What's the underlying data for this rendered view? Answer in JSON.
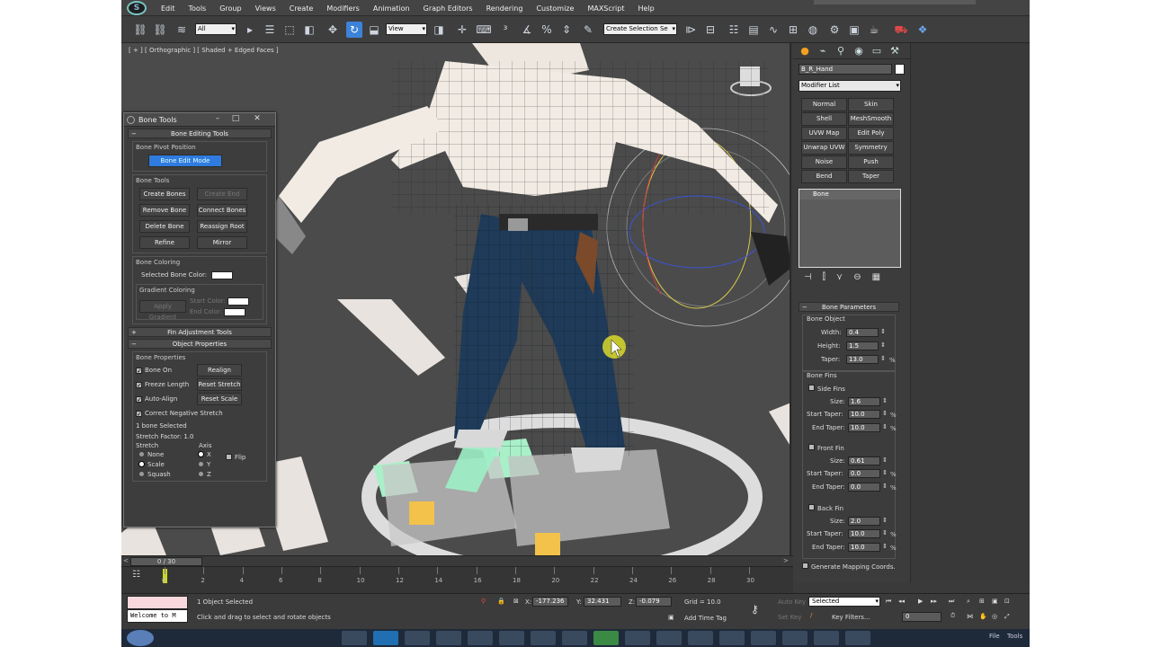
{
  "app": {
    "logo_text": "S"
  },
  "menu": [
    "Edit",
    "Tools",
    "Group",
    "Views",
    "Create",
    "Modifiers",
    "Animation",
    "Graph Editors",
    "Rendering",
    "Customize",
    "MAXScript",
    "Help"
  ],
  "toolbar": {
    "filter_value": "All",
    "refcoord_value": "View",
    "selection_set_placeholder": "Create Selection Se"
  },
  "viewport": {
    "label": "[ + ] [ Orthographic ] [ Shaded + Edged Faces ]"
  },
  "bone_tools": {
    "title": "Bone Tools",
    "editing_header": "Bone Editing Tools",
    "pivot_group": "Bone Pivot Position",
    "bone_edit_mode": "Bone Edit Mode",
    "tools_group": "Bone Tools",
    "buttons": [
      "Create Bones",
      "Create End",
      "Remove Bone",
      "Connect Bones",
      "Delete Bone",
      "Reassign Root",
      "Refine",
      "Mirror"
    ],
    "coloring_group": "Bone Coloring",
    "selected_color_label": "Selected Bone Color:",
    "gradient_group": "Gradient Coloring",
    "apply_gradient": "Apply Gradient",
    "start_color": "Start Color:",
    "end_color": "End Color:",
    "fin_header": "Fin Adjustment Tools",
    "object_props_header": "Object Properties",
    "bone_props_group": "Bone Properties",
    "bone_on": "Bone On",
    "realign": "Realign",
    "freeze_length": "Freeze Length",
    "reset_stretch": "Reset Stretch",
    "auto_align": "Auto-Align",
    "reset_scale": "Reset Scale",
    "correct_neg": "Correct Negative Stretch",
    "selected_count": "1 bone Selected",
    "stretch_factor": "Stretch Factor: 1.0",
    "stretch_label": "Stretch",
    "axis_label": "Axis",
    "flip": "Flip",
    "stretch_options": [
      "None",
      "Scale",
      "Squash"
    ],
    "axis_options": [
      "X",
      "Y",
      "Z"
    ]
  },
  "cmd": {
    "object_name": "B_R_Hand",
    "modifier_list": "Modifier List",
    "modifiers": [
      "Normal",
      "Skin",
      "Shell",
      "MeshSmooth",
      "UVW Map",
      "Edit Poly",
      "Unwrap UVW",
      "Symmetry",
      "Noise",
      "Push",
      "Bend",
      "Taper"
    ],
    "stack_item": "Bone",
    "bone_params_header": "Bone Parameters",
    "bone_object": "Bone Object",
    "width_label": "Width:",
    "width": "0.4",
    "height_label": "Height:",
    "height": "1.5",
    "taper_label": "Taper:",
    "taper": "13.0",
    "bone_fins": "Bone Fins",
    "side_fins": "Side Fins",
    "size_label": "Size:",
    "start_taper_label": "Start Taper:",
    "end_taper_label": "End Taper:",
    "side_size": "1.6",
    "side_start": "10.0",
    "side_end": "10.0",
    "front_fin": "Front Fin",
    "front_size": "0.61",
    "front_start": "0.0",
    "front_end": "0.0",
    "back_fin": "Back Fin",
    "back_size": "2.0",
    "back_start": "10.0",
    "back_end": "10.0",
    "gen_mapping": "Generate Mapping Coords."
  },
  "timeline": {
    "slider": "0 / 30",
    "ticks": [
      "0",
      "2",
      "4",
      "6",
      "8",
      "10",
      "12",
      "14",
      "16",
      "18",
      "20",
      "22",
      "24",
      "26",
      "28",
      "30"
    ]
  },
  "status": {
    "maxscript": "Welcome to M",
    "selected": "1 Object Selected",
    "prompt": "Click and drag to select and rotate objects",
    "x_label": "X:",
    "x": "-177.236",
    "y_label": "Y:",
    "y": "32.431",
    "z_label": "Z:",
    "z": "-0.079",
    "grid": "Grid = 10.0",
    "add_time_tag": "Add Time Tag",
    "auto_key": "Auto Key",
    "set_key": "Set Key",
    "selected_dropdown": "Selected",
    "key_filters": "Key Filters...",
    "frame": "0"
  },
  "taskbar": {
    "items": [
      "File",
      "Tools"
    ]
  }
}
